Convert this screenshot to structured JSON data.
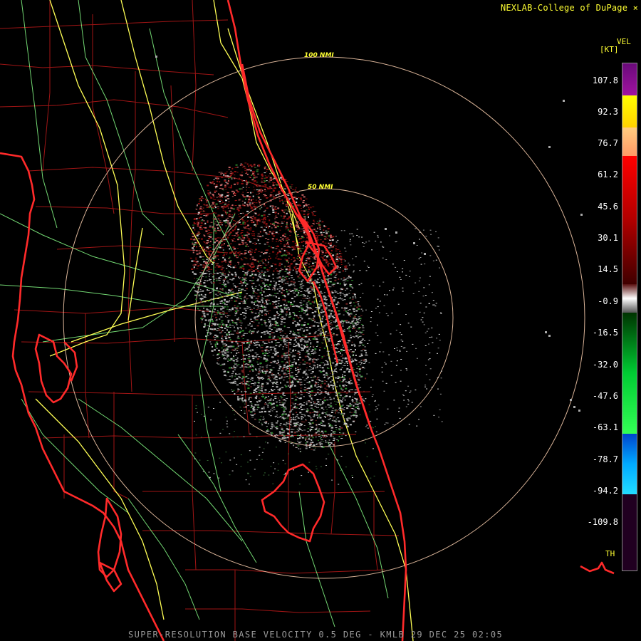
{
  "header": {
    "credit": "NEXLAB-College of DuPage ⨯"
  },
  "footer": {
    "product_line": "SUPER-RESOLUTION BASE VELOCITY 0.5 DEG - KMLB 29 DEC 25 02:05"
  },
  "range_rings": [
    {
      "label": "100 NMI"
    },
    {
      "label": "50 NMI"
    }
  ],
  "legend": {
    "product": "VEL",
    "units": "[KT]",
    "ticks": [
      "107.8",
      "92.3",
      "76.7",
      "61.2",
      "45.6",
      "30.1",
      "14.5",
      "-0.9",
      "-16.5",
      "-32.0",
      "-47.6",
      "-63.1",
      "-78.7",
      "-94.2",
      "-109.8"
    ],
    "th_label": "TH",
    "colors": [
      "#7a0a88",
      "#ffff00",
      "#ffb070",
      "#ff0000",
      "#8b0000",
      "#bbbbbb",
      "#006400",
      "#00ff44",
      "#0066ff",
      "#22ccff",
      "#220022"
    ]
  },
  "colors": {
    "state_boundaries": "#ff2a2a",
    "county_lines": "#a01515",
    "highways": "#ffff55",
    "roads": "#88ff88",
    "rings": "#f2c8a8"
  }
}
